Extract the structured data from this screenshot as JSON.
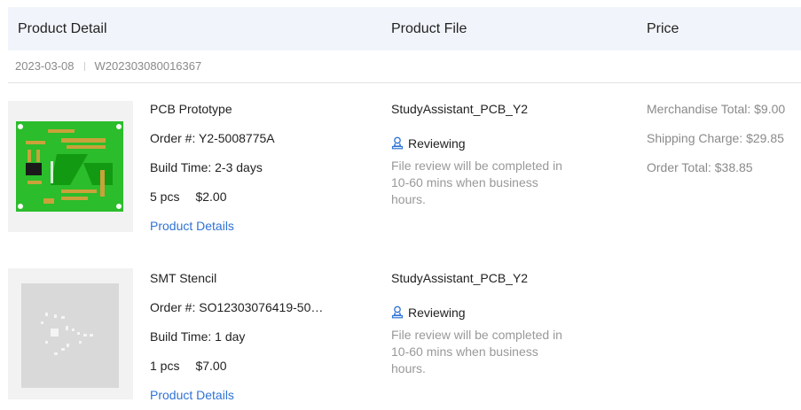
{
  "header": {
    "product_detail": "Product Detail",
    "product_file": "Product File",
    "price": "Price"
  },
  "order": {
    "date": "2023-03-08",
    "number": "W202303080016367"
  },
  "items": [
    {
      "thumbnail": "pcb-board-image",
      "name": "PCB Prototype",
      "order_no": "Order #: Y2-5008775A",
      "build_time": "Build Time: 2-3 days",
      "qty": "5 pcs",
      "unit_price": "$2.00",
      "details_link": "Product Details",
      "file_name": "StudyAssistant_PCB_Y2",
      "status_icon": "reviewer-icon",
      "status": "Reviewing",
      "note": "File review will be completed in 10-60 mins when business hours.",
      "merchandise_total": "Merchandise Total: $9.00",
      "shipping_charge": "Shipping Charge: $29.85",
      "order_total": "Order Total: $38.85"
    },
    {
      "thumbnail": "smt-stencil-image",
      "name": "SMT Stencil",
      "order_no": "Order #: SO12303076419-50…",
      "build_time": "Build Time: 1 day",
      "qty": "1 pcs",
      "unit_price": "$7.00",
      "details_link": "Product Details",
      "file_name": "StudyAssistant_PCB_Y2",
      "status_icon": "reviewer-icon",
      "status": "Reviewing",
      "note": "File review will be completed in 10-60 mins when business hours."
    }
  ],
  "colors": {
    "header_bg": "#f1f5fb",
    "link": "#2f73d6",
    "status_icon": "#2f73d6",
    "pcb_green": "#2bbd2b",
    "muted_text": "#8a8a8a"
  }
}
